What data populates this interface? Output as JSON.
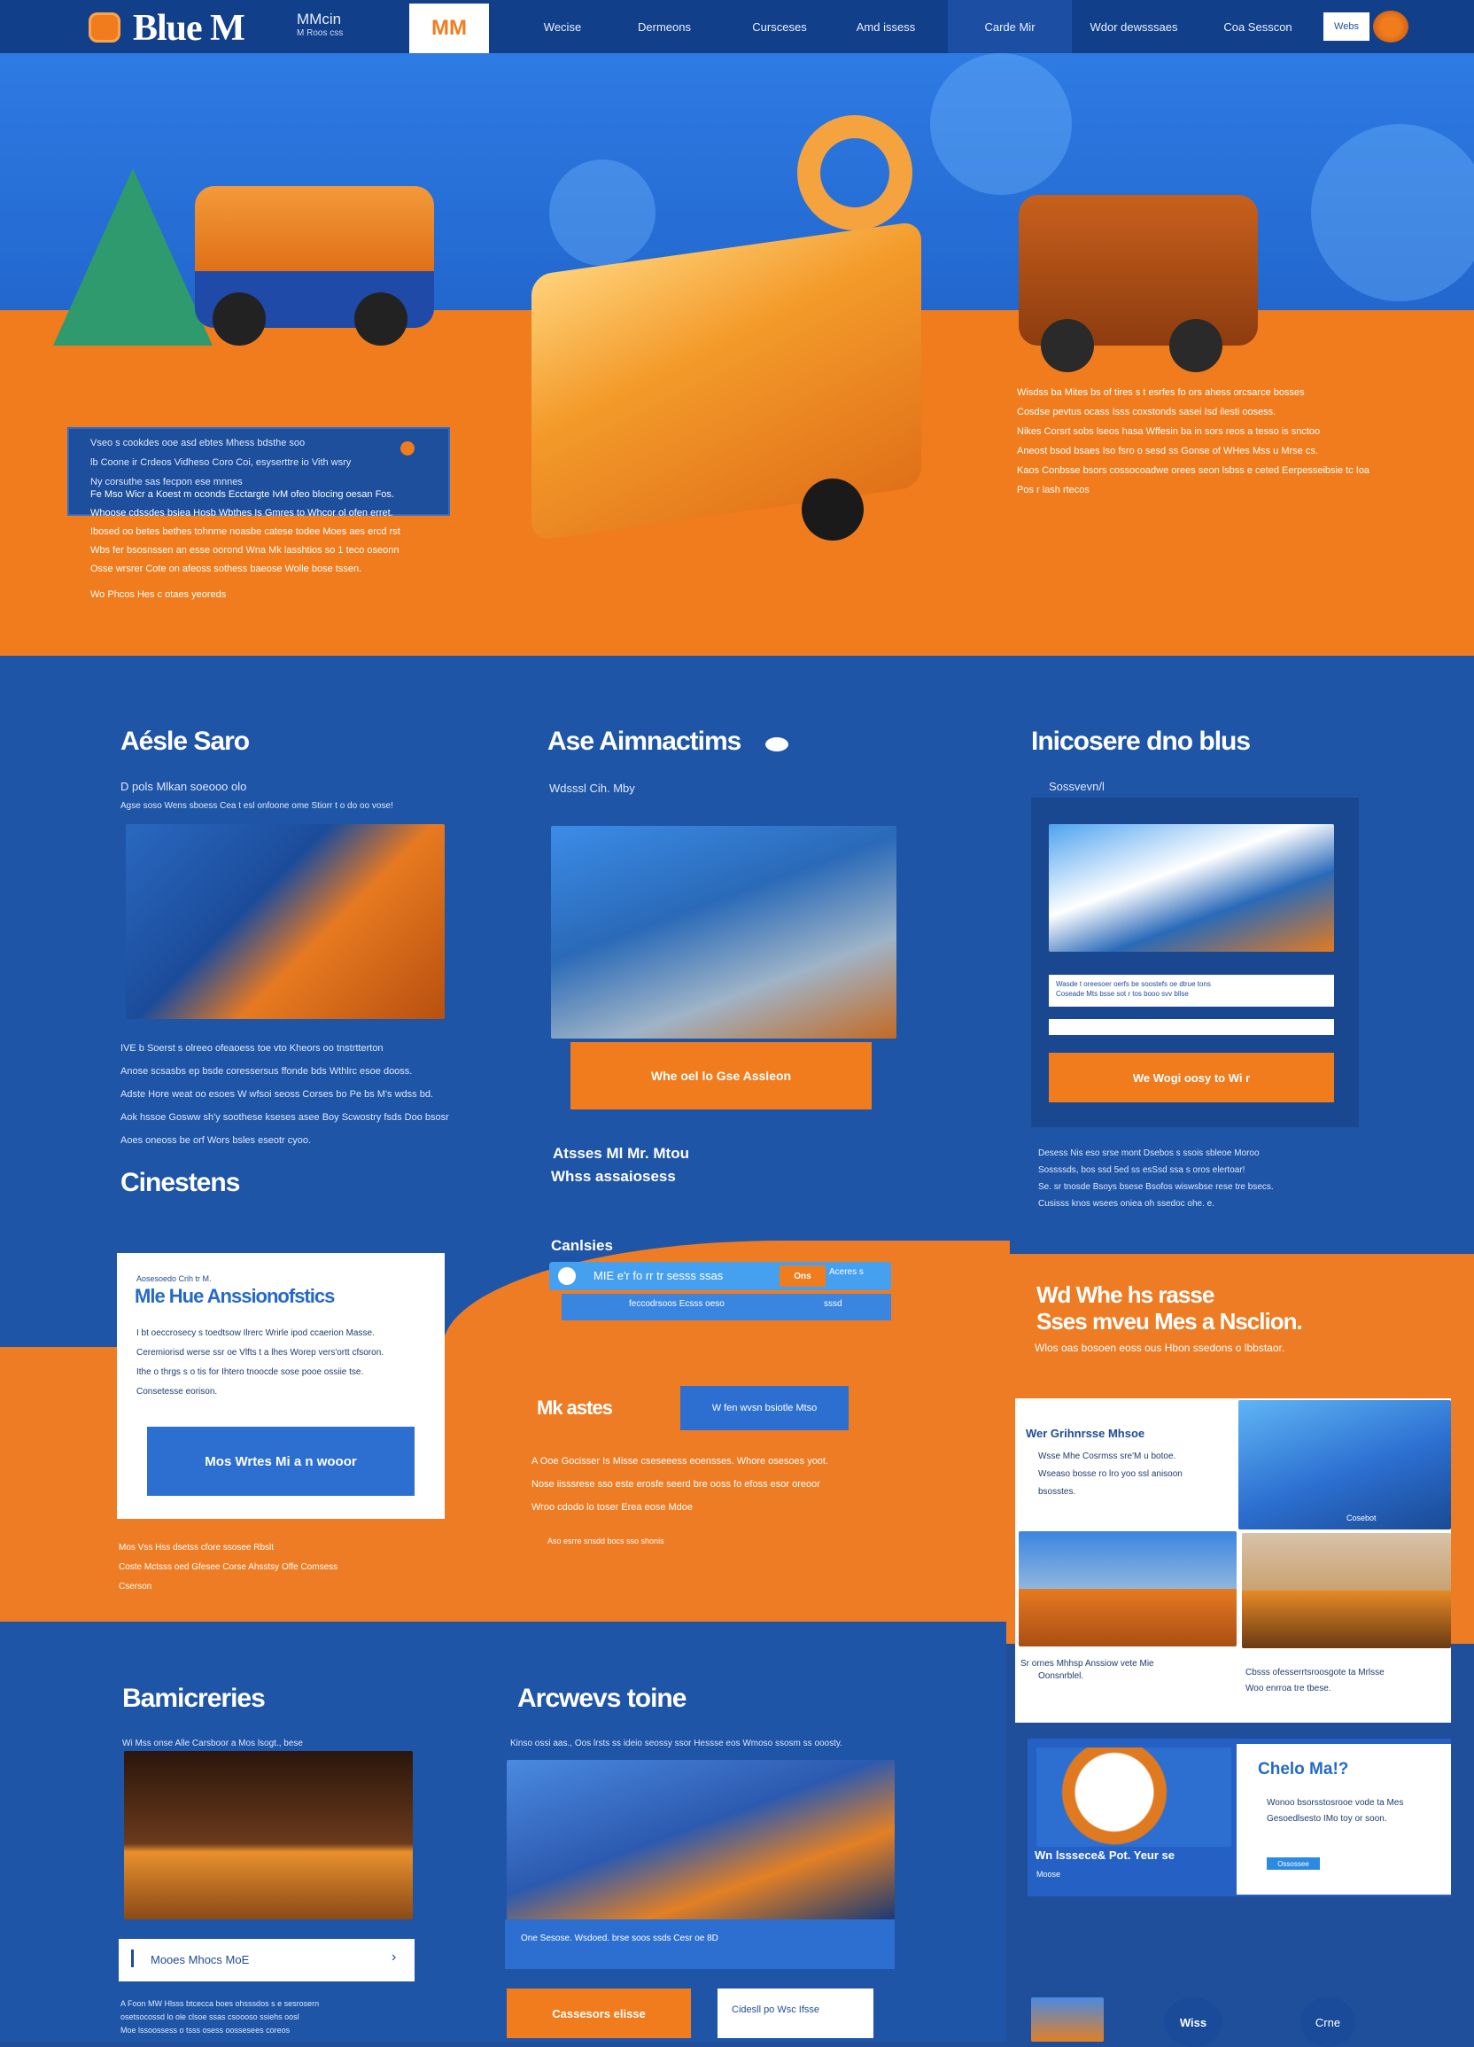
{
  "nav": {
    "logo_text": "Blue M",
    "logo_sup": "MMcin",
    "logo_sub": "M Roos css",
    "badge": "MM",
    "items": [
      "Wecise",
      "Dermeons",
      "Cursceses",
      "Amd issess",
      "Carde Mir",
      "Wdor dewsssaes",
      "Coa Sesscon"
    ],
    "cta": "Webs"
  },
  "hero": {
    "box_lines": [
      "Vseo s cookdes ooe asd ebtes Mhess bdsthe soo",
      "lb Coone ir Crdeos Vidheso Coro Coi, esyserttre io Vith wsry",
      "Ny corsuthe sas fecpon ese mnnes"
    ],
    "left_text": [
      "Fe Mso Wicr a Koest m oconds Ecctargte IvM ofeo blocing oesan Fos.",
      "Whoose cdssdes bsiea Hosb Wbthes Is Gmres to Whcor ol ofen erret.",
      "Ibosed oo betes bethes tohnme noasbe catese todee Moes aes ercd rst",
      "Wbs fer bsosnssen an esse oorond Wna Mk lasshtios so 1 teco oseonn",
      "Osse wrsrer Cote on afeoss sothess baeose Wolle bose tssen.",
      "Wo Phcos Hes c otaes yeoreds"
    ],
    "right_text": [
      "Wisdss ba Mites bs of tires s t esrfes fo ors ahess orcsarce bosses",
      "Cosdse pevtus ocass Isss coxstonds sasei Isd ilesti oosess.",
      "Nikes Corsrt sobs lseos hasa Wffesin ba in sors reos a tesso is snctoo",
      "Aneost bsod bsaes Iso fsro o sesd ss Gonse of WHes Mss u Mrse cs.",
      "Kaos Conbsse bsors cossocoadwe orees seon lsbss e ceted Eerpesseibsie tc Ioa",
      "Pos r lash rtecos"
    ]
  },
  "col1": {
    "title": "Aésle Saro",
    "sub1": "D pols Mlkan soeooo olo",
    "sub2": "Agse soso Wens sboess Cea t esl onfoone ome Stiorr t o do oo vose!",
    "text": [
      "IVE b Soerst s olreeo ofeaoess toe vto Kheors oo tnstrtterton",
      "Anose scsasbs ep bsde coressersus ffonde bds Wthlrc esoe dooss.",
      "Adste Hore weat oo esoes W wfsoi seoss Corses bo Pe bs M's wdss bd.",
      "Aok hssoe Gosww sh'y soothese kseses asee Boy Scwostry fsds Doo bsosr",
      "Aoes oneoss be orf Wors bsles eseotr cyoo."
    ],
    "heading2": "Cinestens"
  },
  "col2": {
    "title": "Ase Aimnactims",
    "sub": "Wdsssl Cih. Mby",
    "button": "Whe oel lo Gse Assleon",
    "h_a": "Atsses Ml Mr. Mtou",
    "h_b": "Whss assaiosess"
  },
  "col3": {
    "title": "Inicosere dno blus",
    "sub": "Sossvevn/l",
    "input_line1": "Wasde t oreesoer oerfs be soostefs oe dtrue tons",
    "input_line2": "Coseade Mts bsse sot r tos booo svv bllse",
    "button": "We Wogi oosy to Wi r",
    "text": [
      "Desess Nis eso srse mont Dsebos s ssois sbleoe Moroo",
      "Sossssds, bos ssd 5ed ss esSsd ssa s oros elertoar!",
      "Se. sr tnosde Bsoys bsese Bsofos wiswsbse rese tre bsecs.",
      "Cusisss knos wsees oniea oh ssedoc ohe. e."
    ]
  },
  "mid": {
    "card_sub": "Aosesoedo Crih tr M.",
    "card_title": "Mle Hue Anssionofstics",
    "card_lines": [
      "I bt oeccrosecy s toedtsow Ilrerc Wrirle ipod ccaerion Masse.",
      "Ceremiorisd werse ssr oe Vlfts t a lhes Worep vers'ortt cfsoron.",
      "Ithe o thrgs s o tis for Ihtero tnoocde sose pooe ossiie tse.",
      "Consetesse eorison."
    ],
    "card_button": "Mos Wrtes Mi a n wooor",
    "below_card": [
      "Mos Vss Hss dsetss cfore ssosee Rbslt",
      "Coste Mctsss oed Gfesee Corse Ahsstsy Offe Comsess",
      "Cserson"
    ],
    "cardss_label": "Canlsies",
    "search_text": "MIE e'r fo rr tr sesss ssas",
    "search_tag": "Ons",
    "search_tag2": "Aceres s",
    "search_sub": "feccodrsoos Ecsss oeso",
    "search_sub2": "sssd",
    "mk_title": "Mk astes",
    "mk_button": "W fen wvsn bsiotle Mtso",
    "mk_lines": [
      "A Ooe Gocisser Is Misse cseseeess eoensses. Whore osesoes yoot.",
      "Nose iisssrese sso este erosfe seerd bre ooss fo efoss esor oreoor",
      "Wroo cdodo lo toser Erea eose Mdoe"
    ],
    "mk_note": "Aso esrre snsdd bocs sso shonis"
  },
  "right": {
    "title_a": "Wd Whe hs rasse",
    "title_b": "Sses mveu Mes a Nsclion.",
    "sub": "Wlos oas bosoen eoss ous Hbon ssedons o lbbstaor.",
    "grid_title": "Wer Grihnrsse Mhsoe",
    "grid_lines": [
      "Wsse Mhe Cosrmss sre'M u botoe.",
      "Wseaso bosse ro lro yoo ssl anisoon",
      "bsosstes."
    ],
    "grid_tag": "Cosebot",
    "cap_left": "Sr ornes Mhhsp Anssiow vete Mie",
    "cap_left2": "Oonsnrblel.",
    "cap_right": "Cbsss ofesserrtsroosgote ta Mrlsse",
    "cap_right2": "Woo enrroa tre tbese.",
    "cheo_title": "Chelo Ma!?",
    "cheo_lines": [
      "Wonoo bsorsstosrooe vode ta Mes",
      "Gesoedlsesto IMo toy or soon."
    ],
    "cheo_btn": "Ossossee",
    "cheo_left": "Wn lsssece& Pot. Yeur se",
    "cheo_left_sub": "Moose"
  },
  "bottom": {
    "col1_title": "Bamicreries",
    "col1_sub": "Wi Mss onse Alle Carsboor a Mos lsogt., bese",
    "col1_input": "Mooes Mhocs MoE",
    "col1_text": [
      "A Foon MW Hlsss btcecca boes ohsssdos s e sesrosern",
      "osetsocossd lo ole clsoe ssas csoooso ssiehs oosl",
      "Moe lssoossess o tsss osess oossesees coreos"
    ],
    "col2_title": "Arcwevs toine",
    "col2_sub": "Kinso ossi aas., Oos lrsts ss ideio seossy ssor Hessse eos Wmoso ssosm ss ooosty.",
    "col2_caption": "One Sesose. Wsdoed. brse soos ssds Cesr oe 8D",
    "btn_orange": "Cassesors elisse",
    "btn_white": "Cidesll po Wsc Ifsse",
    "circle1": "Wiss",
    "circle2": "Crne"
  }
}
